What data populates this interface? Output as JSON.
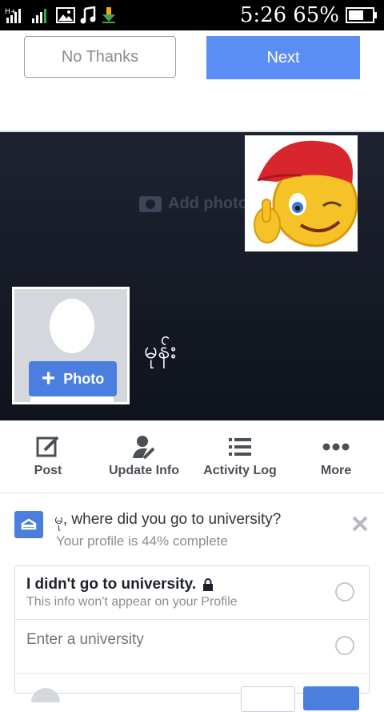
{
  "status_bar": {
    "time": "5:26",
    "battery_percent": "65%",
    "battery_level": 0.65,
    "icons": [
      "data-signal-icon",
      "signal-bars-icon",
      "image-icon",
      "music-note-icon",
      "download-icon"
    ]
  },
  "top": {
    "no_thanks_label": "No Thanks",
    "next_label": "Next"
  },
  "cover": {
    "add_photo_label": "Add photo",
    "profile_photo_button": "Photo",
    "profile_name": "မုန်း"
  },
  "actions": [
    {
      "label": "Post",
      "icon": "edit-icon"
    },
    {
      "label": "Update Info",
      "icon": "user-edit-icon"
    },
    {
      "label": "Activity Log",
      "icon": "list-icon"
    },
    {
      "label": "More",
      "icon": "more-dots-icon"
    }
  ],
  "prompt": {
    "title": "မု, where did you go to university?",
    "subtitle": "Your profile is 44% complete",
    "options": {
      "no_university_title": "I didn't go to university.",
      "no_university_sub": "This info won't appear on your Profile",
      "university_placeholder": "Enter a university"
    }
  },
  "colors": {
    "accent": "#5b8ef5",
    "button_blue": "#4a7fe0",
    "cover_dark": "#151a25",
    "text_gray": "#8a8d91"
  }
}
